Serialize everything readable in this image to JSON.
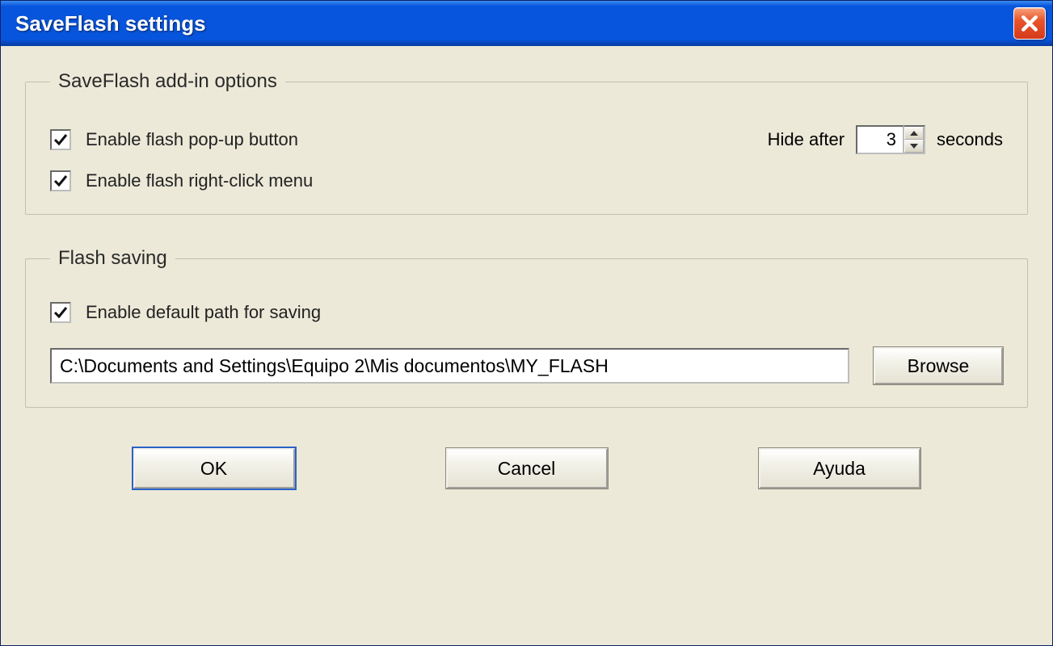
{
  "window": {
    "title": "SaveFlash settings"
  },
  "group1": {
    "legend": "SaveFlash add-in options",
    "popup_label": "Enable flash pop-up button",
    "rightclick_label": "Enable flash right-click menu",
    "hide_after_label": "Hide after",
    "hide_after_value": "3",
    "seconds_label": "seconds"
  },
  "group2": {
    "legend": "Flash saving",
    "defpath_label": "Enable default path for saving",
    "path_value": "C:\\Documents and Settings\\Equipo 2\\Mis documentos\\MY_FLASH",
    "browse_label": "Browse"
  },
  "buttons": {
    "ok": "OK",
    "cancel": "Cancel",
    "help": "Ayuda"
  }
}
